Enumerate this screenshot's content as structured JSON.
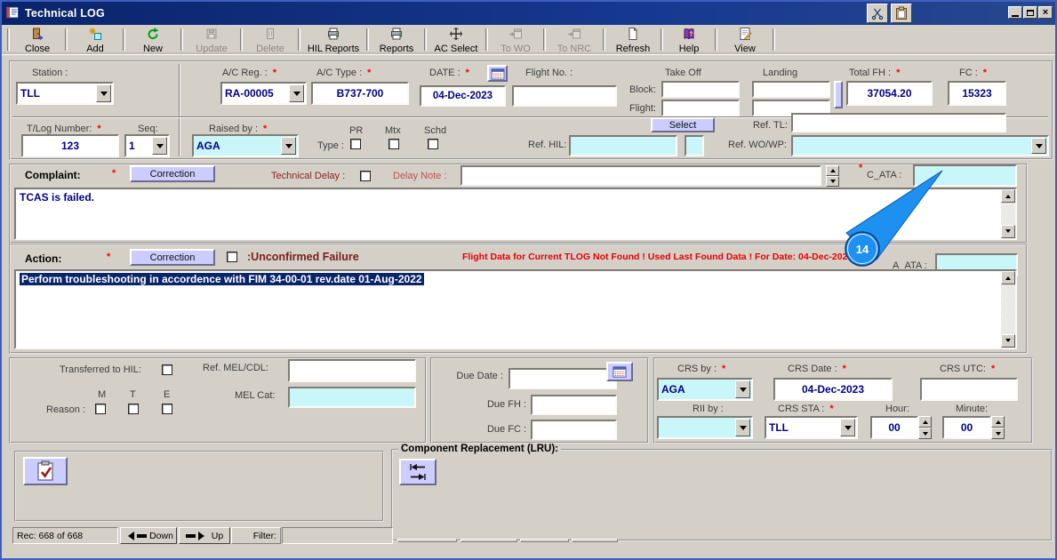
{
  "required_marker": "*",
  "titlebar": {
    "title": "Technical LOG"
  },
  "toolbar": {
    "items": [
      {
        "label": "Close"
      },
      {
        "label": "Add"
      },
      {
        "label": "New"
      },
      {
        "label": "Update"
      },
      {
        "label": "Delete"
      },
      {
        "label": "HIL Reports"
      },
      {
        "label": "Reports"
      },
      {
        "label": "AC Select"
      },
      {
        "label": "To WO"
      },
      {
        "label": "To NRC"
      },
      {
        "label": "Refresh"
      },
      {
        "label": "Help"
      },
      {
        "label": "View"
      }
    ]
  },
  "header": {
    "station_label": "Station :",
    "station_value": "TLL",
    "ac_reg_label": "A/C Reg. :",
    "ac_reg_value": "RA-00005",
    "ac_type_label": "A/C Type :",
    "ac_type_value": "B737-700",
    "date_label": "DATE :",
    "date_value": "04-Dec-2023",
    "flight_no_label": "Flight No. :",
    "flight_no_value": "",
    "take_off_label": "Take Off",
    "landing_label": "Landing",
    "block_label": "Block:",
    "flight_label": "Flight:",
    "block_takeoff": "",
    "block_landing": "",
    "flight_takeoff": "",
    "flight_landing": "",
    "total_fh_label": "Total FH :",
    "total_fh_value": "37054.20",
    "fc_label": "FC :",
    "fc_value": "15323",
    "tlog_label": "T/Log Number:",
    "tlog_value": "123",
    "seq_label": "Seq:",
    "seq_value": "1",
    "raised_by_label": "Raised by :",
    "raised_by_value": "AGA",
    "type_label": "Type :",
    "pr_label": "PR",
    "mtx_label": "Mtx",
    "schd_label": "Schd",
    "select_button": "Select",
    "ref_hil_label": "Ref. HIL:",
    "ref_hil_value": "",
    "ref_tl_label": "Ref. TL:",
    "ref_tl_value": "",
    "ref_wowp_label": "Ref. WO/WP:",
    "ref_wowp_value": ""
  },
  "complaint": {
    "label": "Complaint:",
    "correction_button": "Correction",
    "technical_delay_label": "Technical Delay :",
    "delay_note_label": "Delay Note :",
    "delay_note_value": "",
    "c_ata_label": "C_ATA :",
    "c_ata_value": "",
    "text": "TCAS is failed."
  },
  "action": {
    "label": "Action:",
    "correction_button": "Correction",
    "unconfirmed_label": ":Unconfirmed Failure",
    "warning": "Flight Data for Current TLOG Not Found ! Used Last Found Data ! For Date: 04-Dec-2023",
    "a_ata_label": "A_ATA :",
    "a_ata_value": "",
    "text": "Perform troubleshooting in accordence with FIM 34-00-01 rev.date 01-Aug-2022",
    "annotation_badge": "14"
  },
  "transfer": {
    "transferred_label": "Transferred to HIL:",
    "ref_mel_label": "Ref. MEL/CDL:",
    "ref_mel_value": "",
    "mel_cat_label": "MEL Cat:",
    "mel_cat_value": "",
    "col_m": "M",
    "col_t": "T",
    "col_e": "E",
    "reason_label": "Reason :"
  },
  "due": {
    "due_date_label": "Due Date :",
    "due_date_value": "",
    "due_fh_label": "Due FH :",
    "due_fh_value": "",
    "due_fc_label": "Due FC :",
    "due_fc_value": ""
  },
  "crs": {
    "crs_by_label": "CRS by :",
    "crs_by_value": "AGA",
    "crs_date_label": "CRS Date :",
    "crs_date_value": "04-Dec-2023",
    "crs_utc_label": "CRS UTC:",
    "crs_utc_value": "",
    "rii_by_label": "RII by :",
    "rii_by_value": "",
    "crs_sta_label": "CRS STA :",
    "crs_sta_value": "TLL",
    "hour_label": "Hour:",
    "hour_value": "00",
    "minute_label": "Minute:",
    "minute_value": "00"
  },
  "lru": {
    "title": "Component Replacement (LRU):"
  },
  "statusbar": {
    "record_counter": "Rec: 668 of 668",
    "down_button": "Down",
    "up_button": "Up",
    "filter_label": "Filter:",
    "filter_value": ""
  },
  "colors": {
    "titlebar_blue": "#0a246a",
    "chrome_gray": "#d4d0c8",
    "field_cyan": "#c9f6f9",
    "button_lavender": "#ccccff",
    "value_navy": "#00008c",
    "required_red": "#ff0000",
    "warning_red": "#e80000",
    "label_maroon": "#7b1d1d",
    "badge_blue": "#1e90f0",
    "selection_navy": "#0a246a"
  }
}
